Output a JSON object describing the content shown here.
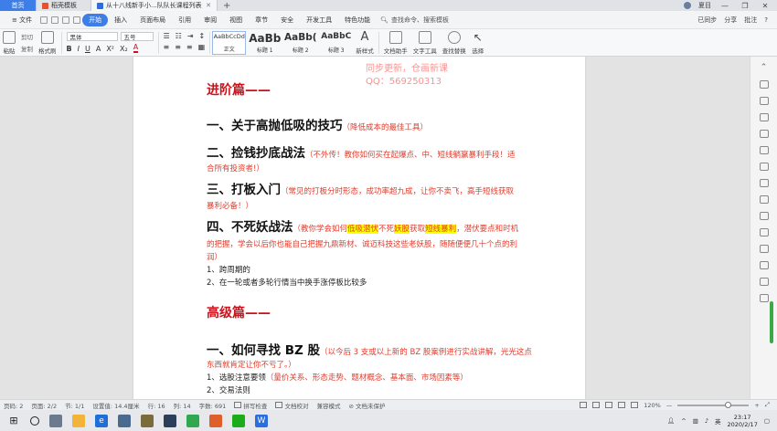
{
  "titlebar": {
    "tabs": [
      {
        "label": "首页"
      },
      {
        "label": "稻壳模板"
      },
      {
        "label": "从十八线新手小...队队长课程列表"
      }
    ],
    "plus": "+",
    "avatar_name": "夏目",
    "minimize": "—",
    "maximize": "❐",
    "close": "✕"
  },
  "menu": {
    "items": [
      "≡ 文件",
      "开始",
      "插入",
      "页面布局",
      "引用",
      "审阅",
      "视图",
      "章节",
      "安全",
      "开发工具",
      "特色功能"
    ],
    "active": "开始",
    "search": "查找命令、搜索模板",
    "sync": "已同步",
    "share": "分享",
    "comment": "批注"
  },
  "ribbon": {
    "paste": "粘贴",
    "cut": "剪切",
    "copy": "复制",
    "format_painter": "格式刷",
    "font_name": "黑体",
    "font_size": "五号",
    "styles": [
      {
        "sample": "AaBbCcDd",
        "name": "正文"
      },
      {
        "sample": "AaBb",
        "name": "标题 1"
      },
      {
        "sample": "AaBb(",
        "name": "标题 2"
      },
      {
        "sample": "AaBbC",
        "name": "标题 3"
      }
    ],
    "new_style": "新样式",
    "writing_assistant": "文档助手",
    "text_tools": "文字工具",
    "find_replace": "查找替换",
    "select": "选择"
  },
  "document": {
    "watermark_1": "同步更新，仓画新课",
    "watermark_2": "QQ：569250313",
    "section_advanced": "进阶篇——",
    "item1_title": "一、关于高抛低吸的技巧",
    "item1_note": "（降低成本的最佳工具）",
    "item2_title": "二、捡钱抄底战法",
    "item2_note_a": "（不外传！教你如何买在起爆点、中、短线躺赢暴利手段！适",
    "item2_note_b": "合所有投资者!）",
    "item3_title": "三、打板入门",
    "item3_note_a": "（常见的打板分时形态，成功率超九成，让你不卖飞，高手短线获取",
    "item3_note_b": "暴利必备！）",
    "item4_title": "四、不死妖战法",
    "item4_note_pre": "（教你学会如何",
    "item4_hl1": "低吸潜伏",
    "item4_mid1": "不死",
    "item4_hl2": "妖股",
    "item4_mid2": "获取",
    "item4_hl3": "短线暴利",
    "item4_note_post": "，潜伏要点和时机",
    "item4_note_b": "的把握，学会以后你也能自己把握九鼎新材、诚迈科技这些老妖股，随随便便几十个点的利",
    "item4_note_c": "润）",
    "item4_sub1": "1、跨周期的",
    "item4_sub2": "2、在一轮或者多轮行情当中换手涨停板比较多",
    "section_senior": "高级篇——",
    "item5_title": "一、如何寻找 BZ 股",
    "item5_note_a": "（以今后 3 支或以上新的 BZ 股案例进行实战讲解，光光这点",
    "item5_note_b": "东西就肯定让你不亏了。）",
    "item5_sub1_pre": "1、选股注意要领",
    "item5_sub1_note": "（量价关系、形态走势、题材概念、基本面、市场因素等）",
    "item5_sub2": "2、交易法则"
  },
  "status": {
    "page": "页码: 2",
    "pages": "页面: 2/2",
    "section": "节: 1/1",
    "position": "设置值: 14.4厘米",
    "row": "行: 16",
    "col": "列: 14",
    "words": "字数: 691",
    "spell": "拼写检查",
    "proof": "文档校对",
    "compat": "兼容模式",
    "unsaved": "文档未保护",
    "zoom": "120%",
    "zoom_value": 120
  },
  "taskbar": {
    "time": "23:17",
    "date": "2020/2/17",
    "ime": "英"
  }
}
